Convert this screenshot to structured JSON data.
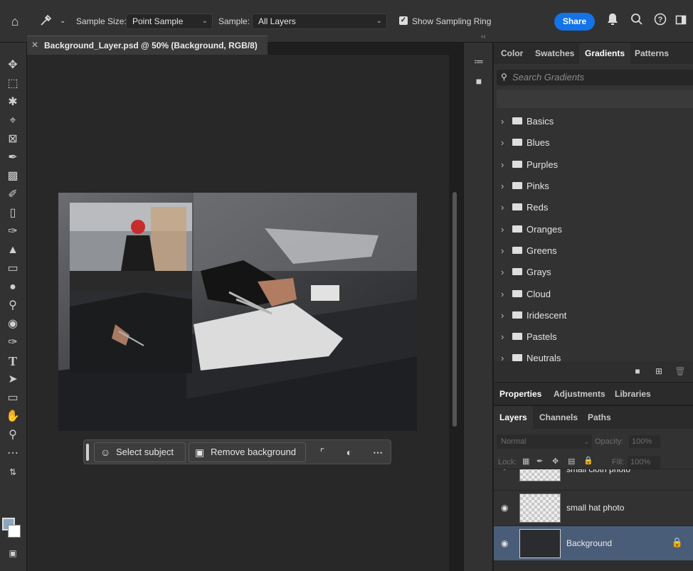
{
  "options_bar": {
    "home_icon": "home-icon",
    "tool_icon": "eyedropper-icon",
    "sample_size_label": "Sample Size:",
    "sample_size_value": "Point Sample",
    "sample_label": "Sample:",
    "sample_value": "All Layers",
    "show_sampling_ring_label": "Show Sampling Ring",
    "show_sampling_ring_checked": true,
    "share_label": "Share",
    "share_color": "#1473e6"
  },
  "document": {
    "tab_title": "Background_Layer.psd @ 50% (Background, RGB/8)"
  },
  "contextual_bar": {
    "select_subject_label": "Select subject",
    "remove_background_label": "Remove background"
  },
  "gradients_panel": {
    "tabs": [
      "Color",
      "Swatches",
      "Gradients",
      "Patterns"
    ],
    "active_tab": "Gradients",
    "search_placeholder": "Search Gradients",
    "groups": [
      "Basics",
      "Blues",
      "Purples",
      "Pinks",
      "Reds",
      "Oranges",
      "Greens",
      "Grays",
      "Cloud",
      "Iridescent",
      "Pastels",
      "Neutrals"
    ]
  },
  "properties_panel": {
    "tabs": [
      "Properties",
      "Adjustments",
      "Libraries"
    ]
  },
  "layers_panel": {
    "tabs": [
      "Layers",
      "Channels",
      "Paths"
    ],
    "blend_mode": "Normal",
    "opacity_label": "Opacity:",
    "opacity_value": "100%",
    "lock_label": "Lock:",
    "fill_label": "Fill:",
    "fill_value": "100%",
    "layers": [
      {
        "name": "small cloth photo",
        "selected": false
      },
      {
        "name": "small hat photo",
        "selected": false
      },
      {
        "name": "Background",
        "selected": true,
        "locked": true
      }
    ],
    "selected_color": "#4a5d78"
  }
}
